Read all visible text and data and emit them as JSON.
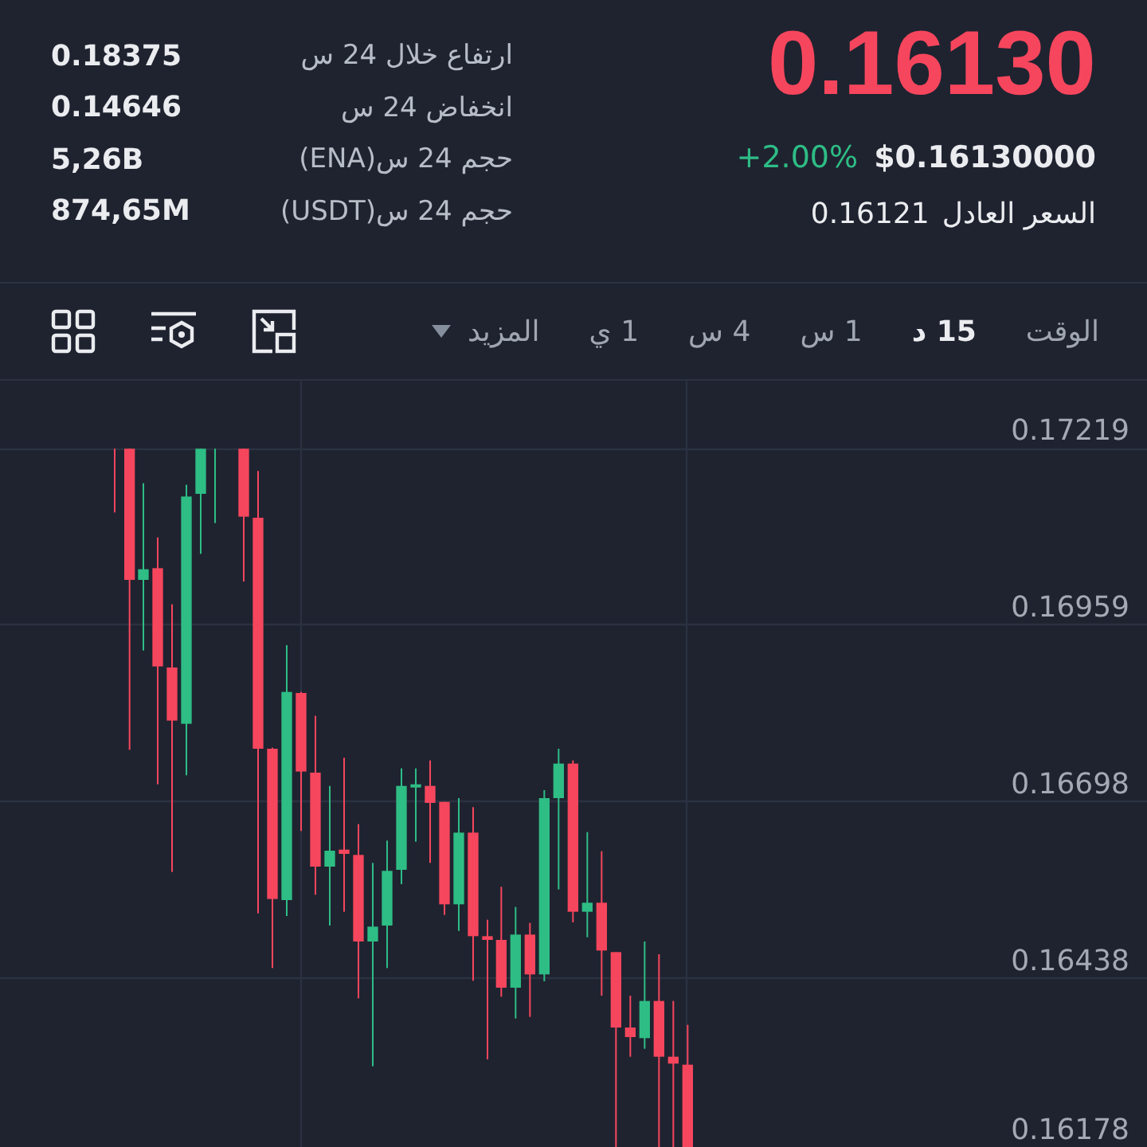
{
  "ticker": {
    "last_price": "0.16130",
    "last_price_falling": true,
    "change": "+2.00%",
    "change_positive": true,
    "usd_price": "$0.16130000",
    "fair_price_label": "السعر العادل",
    "fair_price": "0.16121"
  },
  "stats": [
    {
      "label": "ارتفاع خلال 24 س",
      "value": "0.18375"
    },
    {
      "label": "انخفاض 24 س",
      "value": "0.14646"
    },
    {
      "label": "حجم 24 س(ENA)",
      "value": "5,26B"
    },
    {
      "label": "حجم 24 س(USDT)",
      "value": "874,65M"
    }
  ],
  "chart_toolbar": {
    "intervals": [
      {
        "label": "الوقت",
        "selected": false
      },
      {
        "label": "15 د",
        "selected": true
      },
      {
        "label": "1 س",
        "selected": false
      },
      {
        "label": "4 س",
        "selected": false
      },
      {
        "label": "1 ي",
        "selected": false
      }
    ],
    "more": "المزيد"
  },
  "chart": {
    "price_axis": [
      "0.17219",
      "0.16959",
      "0.16698",
      "0.16438",
      "0.16178"
    ]
  }
}
